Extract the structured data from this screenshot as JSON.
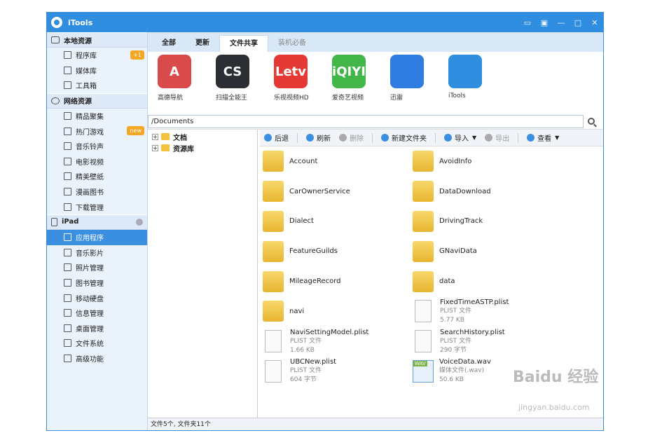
{
  "titlebar": {
    "title": "iTools"
  },
  "sidebar": {
    "local_section": "本地资源",
    "local_items": [
      {
        "label": "程序库",
        "badge": "+1"
      },
      {
        "label": "媒体库"
      },
      {
        "label": "工具箱"
      }
    ],
    "net_section": "网络资源",
    "net_items": [
      {
        "label": "精品聚集"
      },
      {
        "label": "热门游戏",
        "badge": "new"
      },
      {
        "label": "音乐铃声"
      },
      {
        "label": "电影视频"
      },
      {
        "label": "精美壁纸"
      },
      {
        "label": "漫画图书"
      },
      {
        "label": "下载管理"
      }
    ],
    "device_section": "iPad",
    "device_items": [
      {
        "label": "应用程序"
      },
      {
        "label": "音乐影片"
      },
      {
        "label": "照片管理"
      },
      {
        "label": "图书管理"
      },
      {
        "label": "移动硬盘"
      },
      {
        "label": "信息管理"
      },
      {
        "label": "桌面管理"
      },
      {
        "label": "文件系统"
      },
      {
        "label": "高级功能"
      }
    ]
  },
  "tabs": [
    "全部",
    "更新",
    "文件共享",
    "装机必备"
  ],
  "apps": [
    {
      "name": "高德导航",
      "glyph": "A",
      "color": "#d94a4a"
    },
    {
      "name": "扫描全能王",
      "glyph": "CS",
      "color": "#2b2f33"
    },
    {
      "name": "乐视视频HD",
      "glyph": "Letv",
      "color": "#e53935"
    },
    {
      "name": "爱奇艺视频",
      "glyph": "iQIYI",
      "color": "#43b649"
    },
    {
      "name": "迅雷",
      "glyph": "",
      "color": "#2f7de1"
    },
    {
      "name": "iTools",
      "glyph": "",
      "color": "#2f8ee0"
    }
  ],
  "path": {
    "value": "/Documents"
  },
  "tree": [
    "文档",
    "资源库"
  ],
  "toolbar": {
    "back": "后退",
    "refresh": "刷新",
    "delete": "删除",
    "new_folder": "新建文件夹",
    "import": "导入",
    "export": "导出",
    "view": "查看"
  },
  "files": [
    {
      "name": "Account",
      "kind": "folder"
    },
    {
      "name": "AvoidInfo",
      "kind": "folder"
    },
    {
      "name": "CarOwnerService",
      "kind": "folder"
    },
    {
      "name": "DataDownload",
      "kind": "folder"
    },
    {
      "name": "Dialect",
      "kind": "folder"
    },
    {
      "name": "DrivingTrack",
      "kind": "folder"
    },
    {
      "name": "FeatureGuilds",
      "kind": "folder"
    },
    {
      "name": "GNaviData",
      "kind": "folder"
    },
    {
      "name": "MileageRecord",
      "kind": "folder"
    },
    {
      "name": "data",
      "kind": "folder"
    },
    {
      "name": "navi",
      "kind": "folder"
    },
    {
      "name": "FixedTimeASTP.plist",
      "kind": "doc",
      "type": "PLIST 文件",
      "size": "5.77 KB"
    },
    {
      "name": "NaviSettingModel.plist",
      "kind": "doc",
      "type": "PLIST 文件",
      "size": "1.66 KB"
    },
    {
      "name": "SearchHistory.plist",
      "kind": "doc",
      "type": "PLIST 文件",
      "size": "290 字节"
    },
    {
      "name": "UBCNew.plist",
      "kind": "doc",
      "type": "PLIST 文件",
      "size": "604 字节"
    },
    {
      "name": "VoiceData.wav",
      "kind": "wav",
      "type": "媒体文件(.wav)",
      "size": "50.6 KB"
    }
  ],
  "status": "文件5个, 文件夹11个",
  "watermark": {
    "main": "Baidu 经验",
    "sub": "jingyan.baidu.com"
  }
}
